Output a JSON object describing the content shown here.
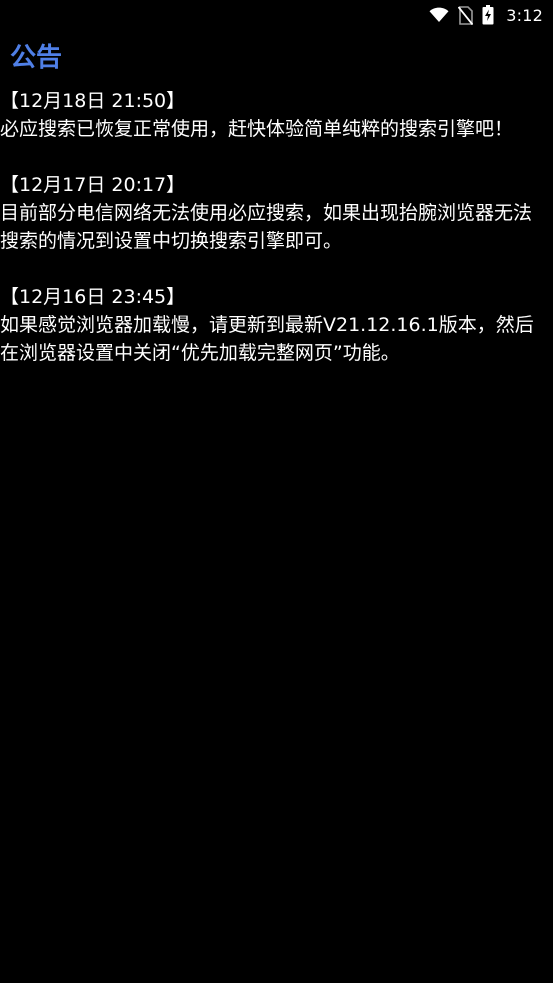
{
  "status_bar": {
    "time": "3:12",
    "icons": [
      "wifi-icon",
      "no-sim-icon",
      "battery-charging-icon"
    ]
  },
  "page": {
    "title": "公告",
    "title_color": "#4f7fe6",
    "background": "#000000",
    "text_color": "#ffffff"
  },
  "announcements": [
    {
      "date": "【12月18日 21:50】",
      "body": "必应搜索已恢复正常使用，赶快体验简单纯粹的搜索引擎吧！"
    },
    {
      "date": "【12月17日 20:17】",
      "body": "目前部分电信网络无法使用必应搜索，如果出现抬腕浏览器无法搜索的情况到设置中切换搜索引擎即可。"
    },
    {
      "date": "【12月16日 23:45】",
      "body": "如果感觉浏览器加载慢，请更新到最新V21.12.16.1版本，然后在浏览器设置中关闭“优先加载完整网页”功能。"
    }
  ]
}
